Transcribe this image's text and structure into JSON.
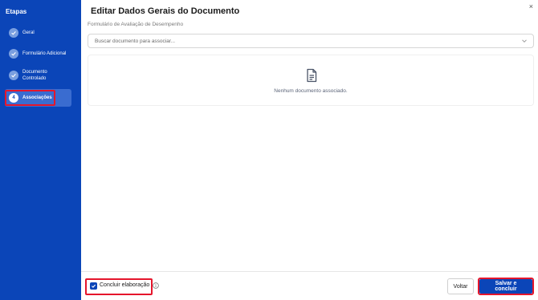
{
  "sidebar": {
    "title": "Etapas",
    "steps": [
      {
        "label": "Geral",
        "status": "completed"
      },
      {
        "label": "Formulário Adicional",
        "status": "completed"
      },
      {
        "label_line1": "Documento",
        "label_line2": "Controlado",
        "status": "completed"
      },
      {
        "number": "4",
        "label": "Associações",
        "status": "active"
      }
    ]
  },
  "dialog": {
    "title": "Editar Dados Gerais do Documento",
    "subtitle": "Formulário de Avaliação de Desempenho",
    "close_icon": "×",
    "search": {
      "placeholder": "Buscar documento para associar..."
    },
    "empty_state": {
      "icon": "document-icon",
      "text": "Nenhum documento associado."
    }
  },
  "footer": {
    "checkbox_label": "Concluir elaboração",
    "checkbox_checked": true,
    "back_label": "Voltar",
    "save_label": "Salvar e concluir"
  },
  "colors": {
    "sidebar_bg": "#0b45b8",
    "primary": "#0b45b8",
    "highlight": "#e5162c"
  }
}
